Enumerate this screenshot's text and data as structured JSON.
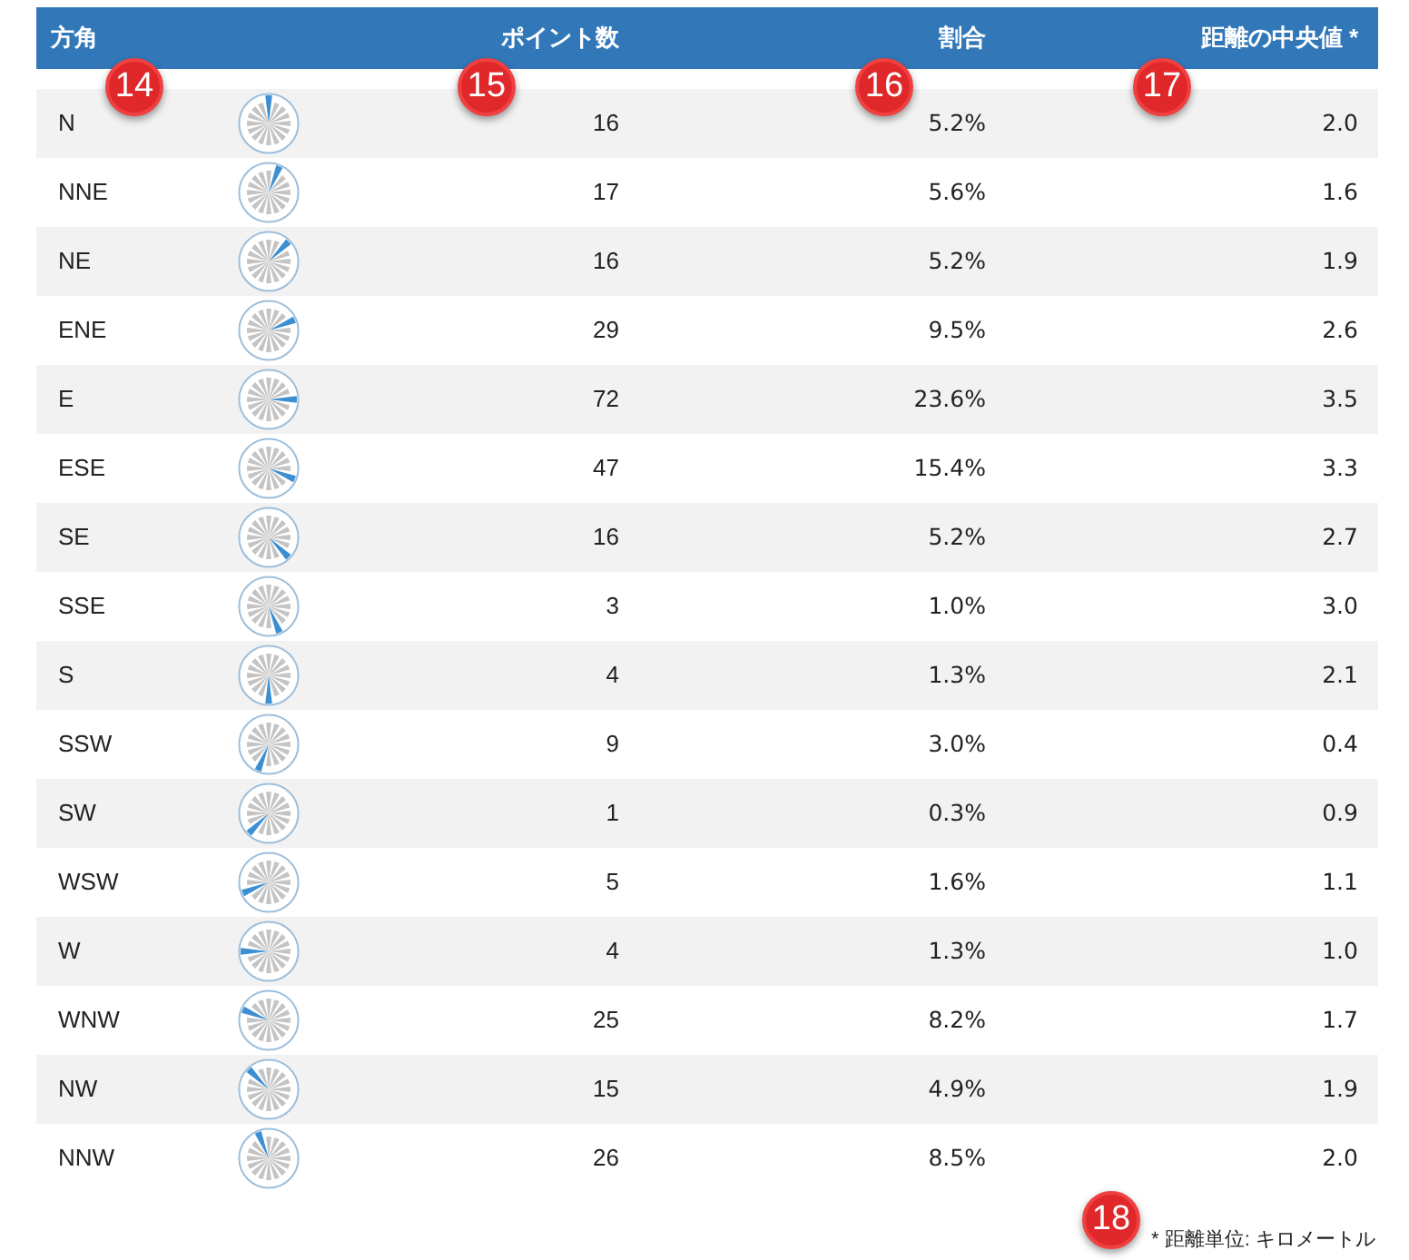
{
  "table": {
    "columns": [
      {
        "label": "方角"
      },
      {
        "label": "ポイント数"
      },
      {
        "label": "割合"
      },
      {
        "label": "距離の中央値 *"
      }
    ],
    "rows": [
      {
        "direction": "N",
        "count": "16",
        "share": "5.2%",
        "median": "2.0"
      },
      {
        "direction": "NNE",
        "count": "17",
        "share": "5.6%",
        "median": "1.6"
      },
      {
        "direction": "NE",
        "count": "16",
        "share": "5.2%",
        "median": "1.9"
      },
      {
        "direction": "ENE",
        "count": "29",
        "share": "9.5%",
        "median": "2.6"
      },
      {
        "direction": "E",
        "count": "72",
        "share": "23.6%",
        "median": "3.5"
      },
      {
        "direction": "ESE",
        "count": "47",
        "share": "15.4%",
        "median": "3.3"
      },
      {
        "direction": "SE",
        "count": "16",
        "share": "5.2%",
        "median": "2.7"
      },
      {
        "direction": "SSE",
        "count": "3",
        "share": "1.0%",
        "median": "3.0"
      },
      {
        "direction": "S",
        "count": "4",
        "share": "1.3%",
        "median": "2.1"
      },
      {
        "direction": "SSW",
        "count": "9",
        "share": "3.0%",
        "median": "0.4"
      },
      {
        "direction": "SW",
        "count": "1",
        "share": "0.3%",
        "median": "0.9"
      },
      {
        "direction": "WSW",
        "count": "5",
        "share": "1.6%",
        "median": "1.1"
      },
      {
        "direction": "W",
        "count": "4",
        "share": "1.3%",
        "median": "1.0"
      },
      {
        "direction": "WNW",
        "count": "25",
        "share": "8.2%",
        "median": "1.7"
      },
      {
        "direction": "NW",
        "count": "15",
        "share": "4.9%",
        "median": "1.9"
      },
      {
        "direction": "NNW",
        "count": "26",
        "share": "8.5%",
        "median": "2.0"
      }
    ]
  },
  "footnote": "* 距離単位: キロメートル",
  "badges": [
    {
      "label": "14"
    },
    {
      "label": "15"
    },
    {
      "label": "16"
    },
    {
      "label": "17"
    },
    {
      "label": "18"
    }
  ]
}
